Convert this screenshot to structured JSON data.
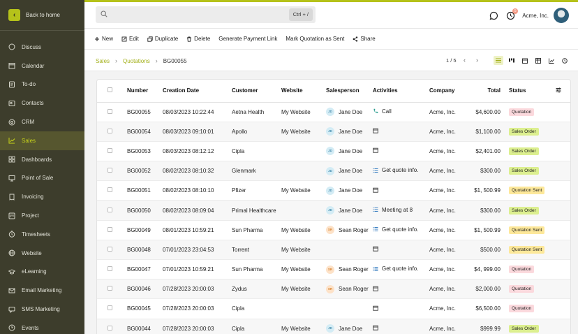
{
  "sidebar": {
    "back_label": "Back to home",
    "items": [
      {
        "label": "Discuss",
        "icon": "chat-bubble-icon"
      },
      {
        "label": "Calendar",
        "icon": "calendar-icon"
      },
      {
        "label": "To-do",
        "icon": "todo-icon"
      },
      {
        "label": "Contacts",
        "icon": "contacts-icon"
      },
      {
        "label": "CRM",
        "icon": "crm-icon"
      },
      {
        "label": "Sales",
        "icon": "sales-chart-icon",
        "active": true
      },
      {
        "label": "Dashboards",
        "icon": "dashboard-icon"
      },
      {
        "label": "Point of Sale",
        "icon": "point-of-sale-icon"
      },
      {
        "label": "Invoicing",
        "icon": "invoice-icon"
      },
      {
        "label": "Project",
        "icon": "project-icon"
      },
      {
        "label": "Timesheets",
        "icon": "timesheet-icon"
      },
      {
        "label": "Website",
        "icon": "globe-icon"
      },
      {
        "label": "eLearning",
        "icon": "graduation-cap-icon"
      },
      {
        "label": "Email Marketing",
        "icon": "email-icon"
      },
      {
        "label": "SMS Marketing",
        "icon": "sms-icon"
      },
      {
        "label": "Events",
        "icon": "events-icon"
      }
    ]
  },
  "header": {
    "search_shortcut": "Ctrl + /",
    "notification_count": "5",
    "company": "Acme, Inc."
  },
  "actions": {
    "new": "New",
    "edit": "Edit",
    "duplicate": "Duplicate",
    "delete": "Delete",
    "payment_link": "Generate Payment Link",
    "mark_sent": "Mark Quotation as Sent",
    "share": "Share"
  },
  "breadcrumb": {
    "root": "Sales",
    "section": "Quotations",
    "current": "BG00055"
  },
  "pager": {
    "label": "1 / 5"
  },
  "table": {
    "columns": {
      "number": "Number",
      "creation_date": "Creation Date",
      "customer": "Customer",
      "website": "Website",
      "salesperson": "Salesperson",
      "activities": "Activities",
      "company": "Company",
      "total": "Total",
      "status": "Status"
    },
    "rows": [
      {
        "number": "BG00055",
        "date": "08/03/2023 10:22:44",
        "customer": "Aetna Health",
        "website": "My Website",
        "sp_initials": "JD",
        "sp_type": "jd",
        "salesperson": "Jane Doe",
        "activity_icon": "phone",
        "activity": "Call",
        "company": "Acme, Inc.",
        "total": "$4,600.00",
        "status": "Quotation"
      },
      {
        "number": "BG00054",
        "date": "08/03/2023 09:10:01",
        "customer": "Apollo",
        "website": "My Website",
        "sp_initials": "JD",
        "sp_type": "jd",
        "salesperson": "Jane Doe",
        "activity_icon": "calendar",
        "activity": "",
        "company": "Acme, Inc.",
        "total": "$1,100.00",
        "status": "Sales Order"
      },
      {
        "number": "BG00053",
        "date": "08/03/2023 08:12:12",
        "customer": "Cipla",
        "website": "",
        "sp_initials": "JD",
        "sp_type": "jd",
        "salesperson": "Jane Doe",
        "activity_icon": "calendar",
        "activity": "",
        "company": "Acme, Inc.",
        "total": "$2,401.00",
        "status": "Sales Order"
      },
      {
        "number": "BG00052",
        "date": "08/02/2023 08:10:32",
        "customer": "Glenmark",
        "website": "",
        "sp_initials": "JD",
        "sp_type": "jd",
        "salesperson": "Jane Doe",
        "activity_icon": "list",
        "activity": "Get quote info.",
        "company": "Acme, Inc.",
        "total": "$300.00",
        "status": "Sales Order"
      },
      {
        "number": "BG00051",
        "date": "08/02/2023 08:10:10",
        "customer": "Pfizer",
        "website": "My Website",
        "sp_initials": "JD",
        "sp_type": "jd",
        "salesperson": "Jane Doe",
        "activity_icon": "calendar",
        "activity": "",
        "company": "Acme, Inc.",
        "total": "$1, 500.99",
        "status": "Quotation Sent"
      },
      {
        "number": "BG00050",
        "date": "08/02/2023 08:09:04",
        "customer": "Primal Healthcare",
        "website": "",
        "sp_initials": "JD",
        "sp_type": "jd",
        "salesperson": "Jane Doe",
        "activity_icon": "list",
        "activity": "Meeting at 8",
        "company": "Acme, Inc.",
        "total": "$300.00",
        "status": "Sales Order"
      },
      {
        "number": "BG00049",
        "date": "08/01/2023  10:59:21",
        "customer": "Sun Pharma",
        "website": "My Website",
        "sp_initials": "SR",
        "sp_type": "sr",
        "salesperson": "Sean Roger",
        "activity_icon": "list",
        "activity": "Get quote info.",
        "company": "Acme, Inc.",
        "total": "$1, 500.99",
        "status": "Quotation Sent"
      },
      {
        "number": "BG00048",
        "date": "07/01/2023 23:04:53",
        "customer": "Torrent",
        "website": "My Website",
        "sp_initials": "",
        "sp_type": "none",
        "salesperson": "",
        "activity_icon": "calendar",
        "activity": "",
        "company": "Acme, Inc.",
        "total": "$500.00",
        "status": "Quotation Sent"
      },
      {
        "number": "BG00047",
        "date": "07/01/2023  10:59:21",
        "customer": "Sun Pharma",
        "website": "My Website",
        "sp_initials": "SR",
        "sp_type": "sr",
        "salesperson": "Sean Roger",
        "activity_icon": "list",
        "activity": "Get quote info.",
        "company": "Acme, Inc.",
        "total": "$4, 999.00",
        "status": "Quotation"
      },
      {
        "number": "BG00046",
        "date": "07/28/2023 20:00:03",
        "customer": "Zydus",
        "website": "My Website",
        "sp_initials": "SR",
        "sp_type": "sr",
        "salesperson": "Sean Roger",
        "activity_icon": "calendar",
        "activity": "",
        "company": "Acme, Inc.",
        "total": "$2,000.00",
        "status": "Quotation"
      },
      {
        "number": "BG00045",
        "date": "07/28/2023 20:00:03",
        "customer": "Cipla",
        "website": "",
        "sp_initials": "",
        "sp_type": "none",
        "salesperson": "",
        "activity_icon": "calendar",
        "activity": "",
        "company": "Acme, Inc.",
        "total": "$6,500.00",
        "status": "Quotation"
      },
      {
        "number": "BG00044",
        "date": "07/28/2023 20:00:03",
        "customer": "Cipla",
        "website": "My Website",
        "sp_initials": "JD",
        "sp_type": "jd",
        "salesperson": "Jane Doe",
        "activity_icon": "calendar",
        "activity": "",
        "company": "Acme, Inc.",
        "total": "$999.99",
        "status": "Sales Order"
      }
    ]
  },
  "status_colors": {
    "Quotation": "#fbd9dd",
    "Sales Order": "#dcef8f",
    "Quotation Sent": "#fde89a",
    "Cancelled": "#e4e4e4"
  },
  "accent": "#b5c21a"
}
